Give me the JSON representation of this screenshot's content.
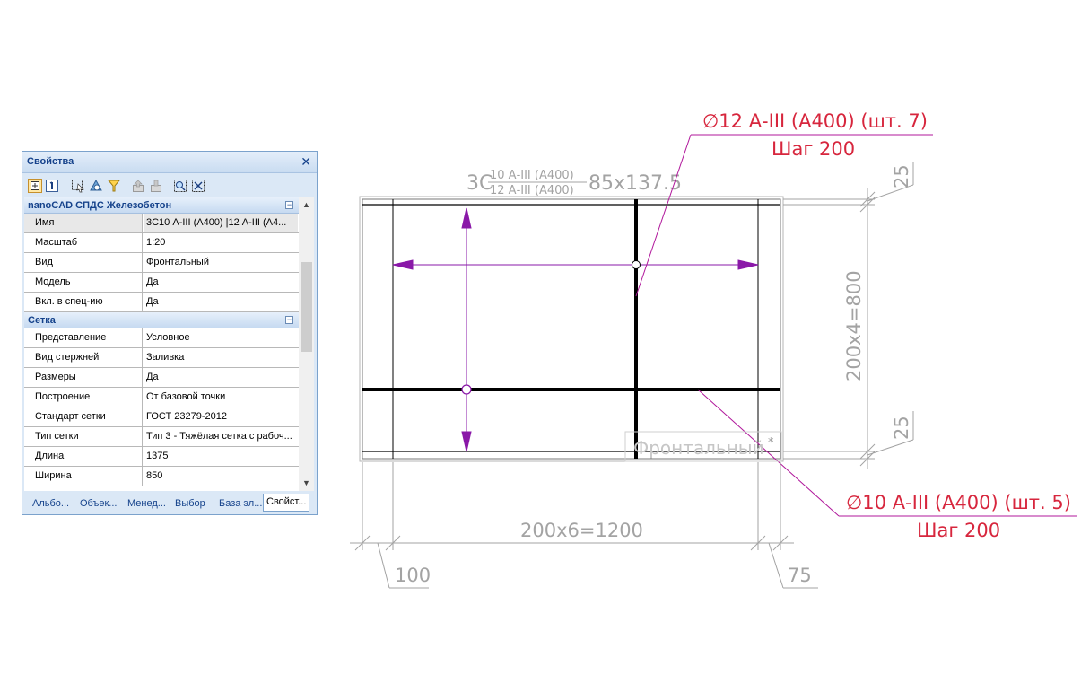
{
  "panel": {
    "title": "Свойства",
    "close_glyph": "✕",
    "group1": {
      "label": "nanoCAD СПДС Железобетон",
      "rows": [
        {
          "key": "Имя",
          "value": "3С10 А-III (А400) |12 А-III (А4..."
        },
        {
          "key": "Масштаб",
          "value": "1:20"
        },
        {
          "key": "Вид",
          "value": "Фронтальный"
        },
        {
          "key": "Модель",
          "value": "Да"
        },
        {
          "key": "Вкл. в спец-ию",
          "value": "Да"
        }
      ]
    },
    "group2": {
      "label": "Сетка",
      "rows": [
        {
          "key": "Представление",
          "value": "Условное"
        },
        {
          "key": "Вид стержней",
          "value": "Заливка"
        },
        {
          "key": "Размеры",
          "value": "Да"
        },
        {
          "key": "Построение",
          "value": "От базовой точки"
        },
        {
          "key": "Стандарт сетки",
          "value": "ГОСТ 23279-2012"
        },
        {
          "key": "Тип сетки",
          "value": "Тип 3 - Тяжёлая сетка с рабоч..."
        },
        {
          "key": "Длина",
          "value": "1375"
        },
        {
          "key": "Ширина",
          "value": "850"
        }
      ]
    },
    "tabs": [
      "Альбо...",
      "Объек...",
      "Менед...",
      "Выбор",
      "База эл...",
      "Свойст..."
    ],
    "active_tab_index": 5,
    "toolbar_icons": [
      "categorize-icon",
      "alphabetical-icon",
      "select-objects-icon",
      "quick-select-icon",
      "filter-icon",
      "export-icon",
      "import-icon",
      "zoom-selection-icon",
      "deselect-icon"
    ]
  },
  "drawing": {
    "mark_prefix": "3С",
    "mark_numerator": "10 А-III (А400)",
    "mark_denominator": "12 А-III (А400)",
    "mark_suffix": "85х137.5",
    "top_leader_line1": "∅12 А-III (А400) (шт. 7)",
    "top_leader_line2": "Шаг 200",
    "bottom_leader_line1": "∅10 А-III (А400) (шт. 5)",
    "bottom_leader_line2": "Шаг 200",
    "dim_bottom_main": "200х6=1200",
    "dim_bottom_left": "100",
    "dim_bottom_right": "75",
    "dim_right_main": "200х4=800",
    "dim_right_top": "25",
    "dim_right_bottom": "25",
    "view_label": "Фронтальный",
    "view_asterisk": "*",
    "colors": {
      "leader": "#d7263d",
      "leader_line": "#b0179b",
      "grip": "#8a18a8",
      "dimension": "#a3a3a3",
      "bar": "#000000",
      "panel_header": "#15428b"
    }
  }
}
